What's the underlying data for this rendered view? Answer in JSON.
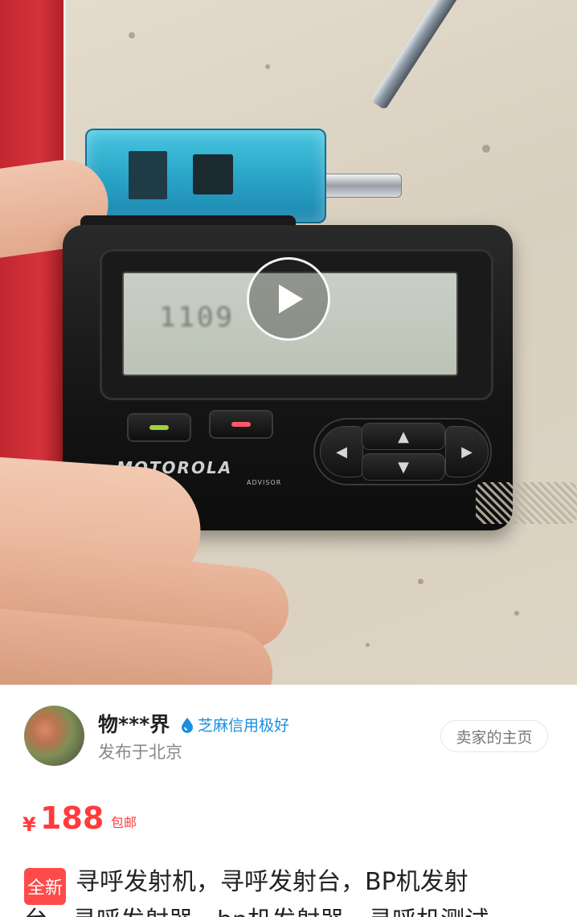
{
  "video": {
    "play_icon": "play-icon",
    "lcd_text": "1109",
    "brand_text": "MOTOROLA",
    "brand_sub": "ADVISOR"
  },
  "seller": {
    "name": "物***界",
    "credit_icon": "water-drop-icon",
    "credit_label": "芝麻信用极好",
    "location": "发布于北京",
    "home_button": "卖家的主页"
  },
  "item": {
    "currency": "¥",
    "price": "188",
    "shipping": "包邮",
    "condition": "全新",
    "title_line1": "寻呼发射机，寻呼发射台，BP机发射",
    "title_line2": "台，寻呼发射器，bp机发射器，寻呼机测试"
  },
  "colors": {
    "price_red": "#ff3b3b",
    "credit_blue": "#1a8fe0",
    "condition_badge": "#ff4a4a"
  }
}
